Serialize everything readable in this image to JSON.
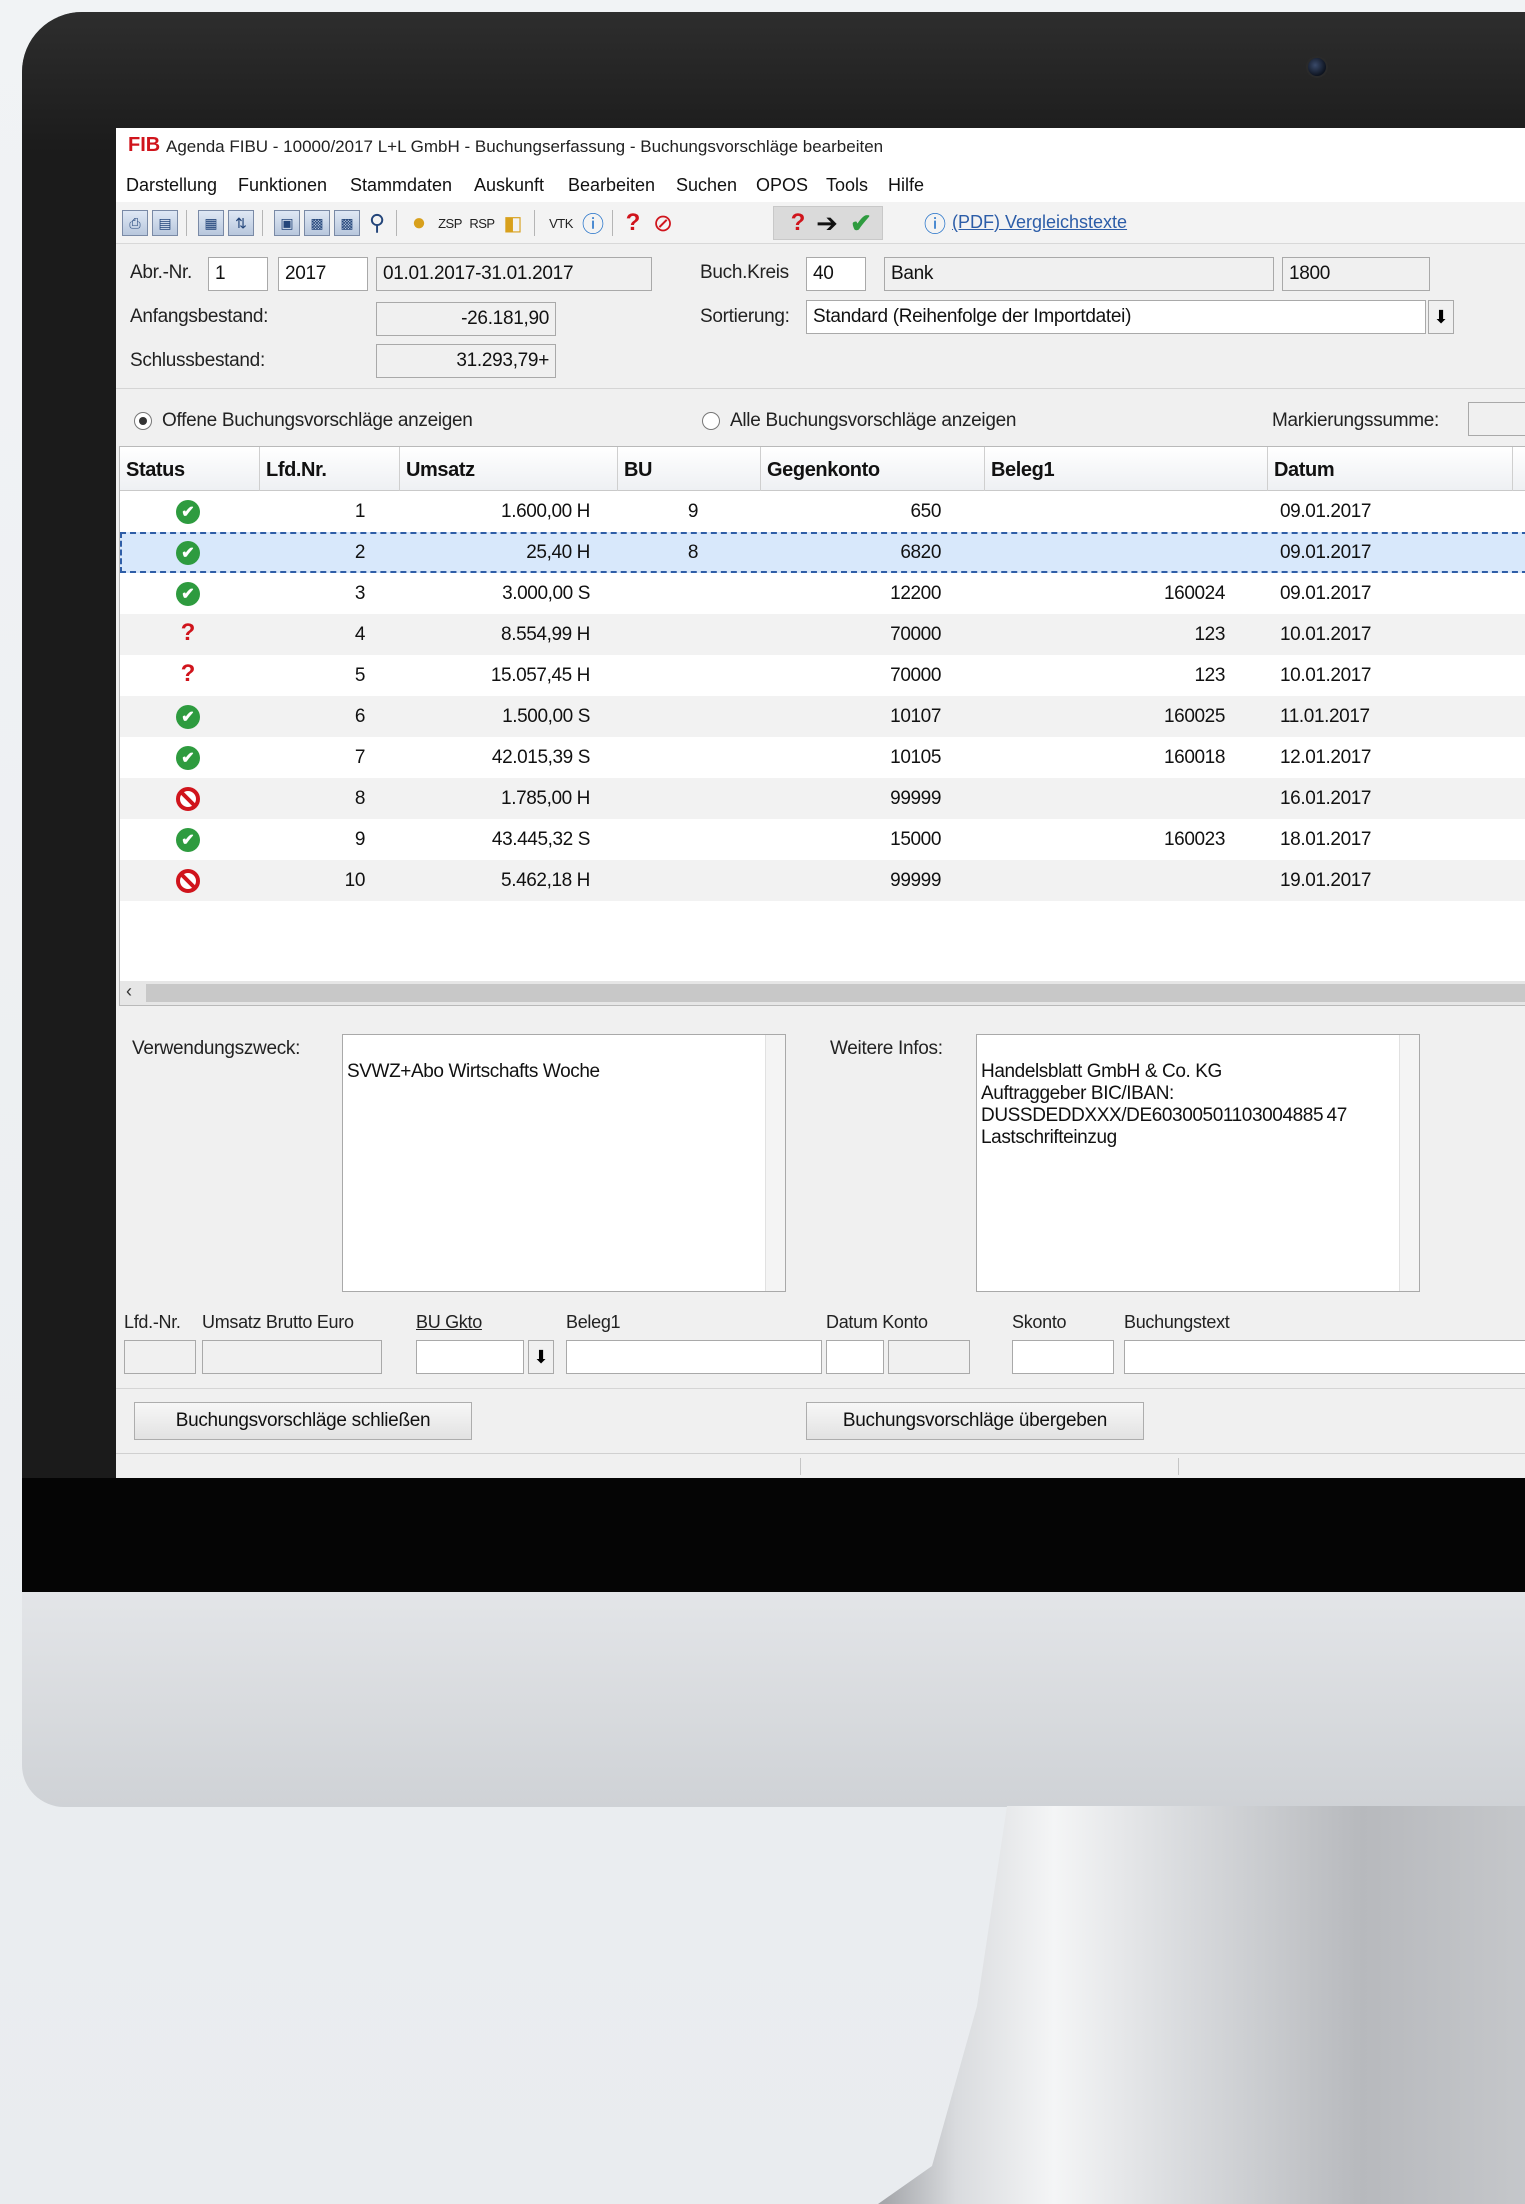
{
  "window": {
    "logo": "FIB",
    "title": "Agenda FIBU - 10000/2017 L+L GmbH - Buchungserfassung - Buchungsvorschläge bearbeiten"
  },
  "menu": [
    "Darstellung",
    "Funktionen",
    "Stammdaten",
    "Auskunft",
    "Bearbeiten",
    "Suchen",
    "OPOS",
    "Tools",
    "Hilfe"
  ],
  "toolbar": {
    "text_buttons": [
      "ZSP",
      "RSP",
      "VTK"
    ],
    "pdf_link": "(PDF) Vergleichstexte"
  },
  "header": {
    "abr_nr_label": "Abr.-Nr.",
    "abr_nr": "1",
    "year": "2017",
    "period": "01.01.2017-31.01.2017",
    "anfangsbestand_label": "Anfangsbestand:",
    "anfangsbestand": "-26.181,90",
    "schlussbestand_label": "Schlussbestand:",
    "schlussbestand": "31.293,79+",
    "buchkreis_label": "Buch.Kreis",
    "buchkreis": "40",
    "buchkreis_name": "Bank",
    "buchkreis_konto": "1800",
    "sortierung_label": "Sortierung:",
    "sortierung": "Standard (Reihenfolge der Importdatei)"
  },
  "filter": {
    "radio_open": "Offene Buchungsvorschläge anzeigen",
    "radio_all": "Alle Buchungsvorschläge anzeigen",
    "selected": "open",
    "markierungssumme_label": "Markierungssumme:"
  },
  "grid": {
    "columns": [
      "Status",
      "Lfd.Nr.",
      "Umsatz",
      "BU",
      "Gegenkonto",
      "Beleg1",
      "Datum"
    ],
    "rows": [
      {
        "status": "ok",
        "nr": "1",
        "umsatz": "1.600,00 H",
        "bu": "9",
        "gegenkonto": "650",
        "beleg1": "",
        "datum": "09.01.2017"
      },
      {
        "status": "ok",
        "nr": "2",
        "umsatz": "25,40 H",
        "bu": "8",
        "gegenkonto": "6820",
        "beleg1": "",
        "datum": "09.01.2017"
      },
      {
        "status": "ok",
        "nr": "3",
        "umsatz": "3.000,00 S",
        "bu": "",
        "gegenkonto": "12200",
        "beleg1": "160024",
        "datum": "09.01.2017"
      },
      {
        "status": "question",
        "nr": "4",
        "umsatz": "8.554,99 H",
        "bu": "",
        "gegenkonto": "70000",
        "beleg1": "123",
        "datum": "10.01.2017"
      },
      {
        "status": "question",
        "nr": "5",
        "umsatz": "15.057,45 H",
        "bu": "",
        "gegenkonto": "70000",
        "beleg1": "123",
        "datum": "10.01.2017"
      },
      {
        "status": "ok",
        "nr": "6",
        "umsatz": "1.500,00 S",
        "bu": "",
        "gegenkonto": "10107",
        "beleg1": "160025",
        "datum": "11.01.2017"
      },
      {
        "status": "ok",
        "nr": "7",
        "umsatz": "42.015,39 S",
        "bu": "",
        "gegenkonto": "10105",
        "beleg1": "160018",
        "datum": "12.01.2017"
      },
      {
        "status": "blocked",
        "nr": "8",
        "umsatz": "1.785,00 H",
        "bu": "",
        "gegenkonto": "99999",
        "beleg1": "",
        "datum": "16.01.2017"
      },
      {
        "status": "ok",
        "nr": "9",
        "umsatz": "43.445,32 S",
        "bu": "",
        "gegenkonto": "15000",
        "beleg1": "160023",
        "datum": "18.01.2017"
      },
      {
        "status": "blocked",
        "nr": "10",
        "umsatz": "5.462,18 H",
        "bu": "",
        "gegenkonto": "99999",
        "beleg1": "",
        "datum": "19.01.2017"
      }
    ],
    "selected_row": 2
  },
  "details": {
    "verwendungszweck_label": "Verwendungszweck:",
    "verwendungszweck": "SVWZ+Abo Wirtschafts Woche",
    "weitere_infos_label": "Weitere Infos:",
    "weitere_infos": "Handelsblatt GmbH & Co. KG\nAuftraggeber BIC/IBAN:\nDUSSDEDDXXX/DE60300501103004885 47\nLastschrifteinzug"
  },
  "entry": {
    "lfd_nr_label": "Lfd.-Nr.",
    "umsatz_label": "Umsatz Brutto Euro",
    "bu_gkto_label": "BU Gkto",
    "beleg1_label": "Beleg1",
    "datum_konto_label": "Datum Konto",
    "skonto_label": "Skonto",
    "buchungstext_label": "Buchungstext"
  },
  "buttons": {
    "close": "Buchungsvorschläge schließen",
    "submit": "Buchungsvorschläge übergeben"
  }
}
